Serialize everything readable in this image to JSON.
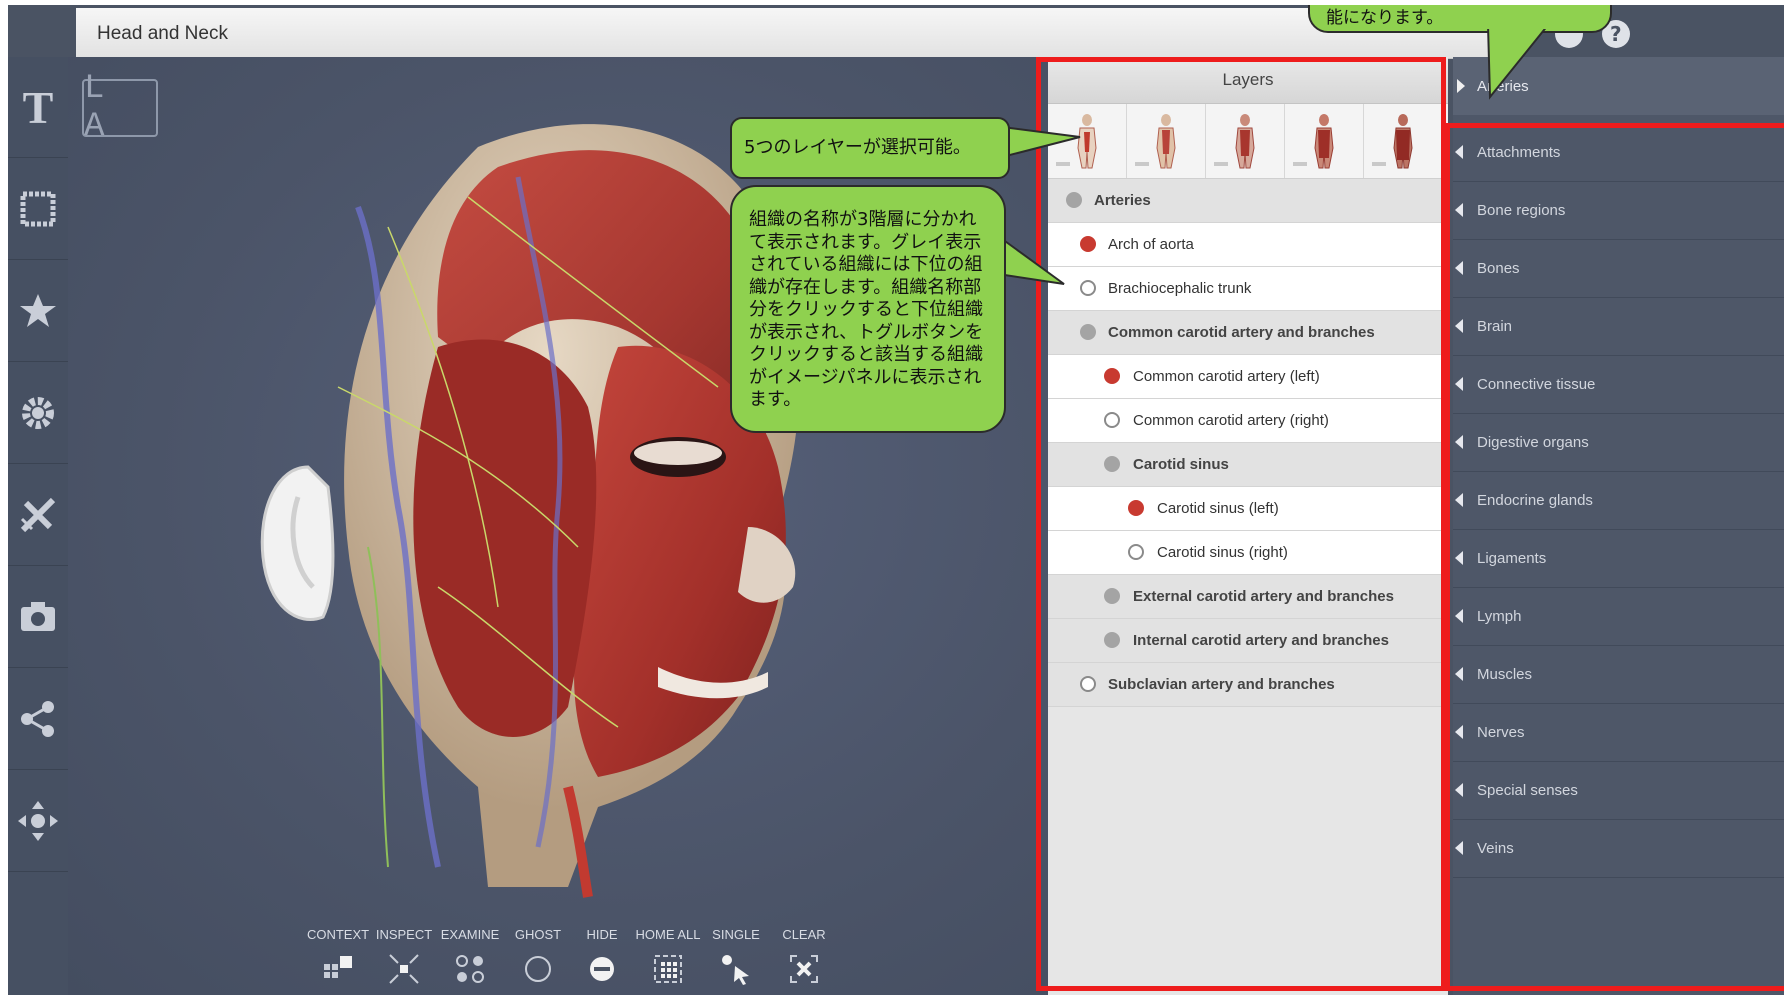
{
  "window": {
    "title": "Head and Neck"
  },
  "viewport": {
    "orientation_badge": "L A",
    "bottom_toolbar": [
      {
        "label": "CONTEXT",
        "icon": "context-icon"
      },
      {
        "label": "INSPECT",
        "icon": "inspect-icon"
      },
      {
        "label": "EXAMINE",
        "icon": "examine-icon"
      },
      {
        "label": "GHOST",
        "icon": "ghost-icon"
      },
      {
        "label": "HIDE",
        "icon": "hide-icon"
      },
      {
        "label": "HOME ALL",
        "icon": "home-all-icon"
      },
      {
        "label": "SINGLE",
        "icon": "single-icon"
      },
      {
        "label": "CLEAR",
        "icon": "clear-icon"
      }
    ]
  },
  "left_toolbar": [
    {
      "icon": "text-icon"
    },
    {
      "icon": "frame-icon"
    },
    {
      "icon": "star-icon"
    },
    {
      "icon": "gear-icon"
    },
    {
      "icon": "dissect-icon"
    },
    {
      "icon": "camera-icon"
    },
    {
      "icon": "share-icon"
    },
    {
      "icon": "move-icon"
    }
  ],
  "layers_panel": {
    "header": "Layers",
    "layer_count": 5,
    "tree": [
      {
        "label": "Arteries",
        "type": "group",
        "state": "grey",
        "level": 0
      },
      {
        "label": "Arch of aorta",
        "type": "leaf",
        "state": "red",
        "level": 1
      },
      {
        "label": "Brachiocephalic trunk",
        "type": "leaf",
        "state": "empty",
        "level": 1
      },
      {
        "label": "Common carotid artery and branches",
        "type": "group",
        "state": "grey",
        "level": 1
      },
      {
        "label": "Common carotid artery (left)",
        "type": "leaf",
        "state": "red",
        "level": 2
      },
      {
        "label": "Common carotid artery (right)",
        "type": "leaf",
        "state": "empty",
        "level": 2
      },
      {
        "label": "Carotid sinus",
        "type": "group",
        "state": "grey",
        "level": 2
      },
      {
        "label": "Carotid sinus (left)",
        "type": "leaf",
        "state": "red",
        "level": 3
      },
      {
        "label": "Carotid sinus (right)",
        "type": "leaf",
        "state": "empty",
        "level": 3
      },
      {
        "label": "External carotid artery and branches",
        "type": "group",
        "state": "grey",
        "level": 2
      },
      {
        "label": "Internal carotid artery and branches",
        "type": "group",
        "state": "grey",
        "level": 2
      },
      {
        "label": "Subclavian artery and branches",
        "type": "group",
        "state": "empty",
        "level": 1
      }
    ]
  },
  "right_nav": {
    "active": "Arteries",
    "items": [
      "Attachments",
      "Bone regions",
      "Bones",
      "Brain",
      "Connective tissue",
      "Digestive organs",
      "Endocrine glands",
      "Ligaments",
      "Lymph",
      "Muscles",
      "Nerves",
      "Special senses",
      "Veins"
    ]
  },
  "annotations": {
    "layers_note": "5つのレイヤーが選択可能。",
    "tree_note": "組織の名称が3階層に分かれて表示されます。グレイ表示されている組織には下位の組織が存在します。組織名称部分をクリックすると下位組織が表示され、トグルボタンをクリックすると該当する組織がイメージパネルに表示されます。",
    "nav_note_partial": "能になります。"
  },
  "colors": {
    "viewport_bg": "#4a5363",
    "highlight_red": "#ee1c1c",
    "callout_green": "#8fd14f",
    "artery_red": "#c83a30"
  }
}
